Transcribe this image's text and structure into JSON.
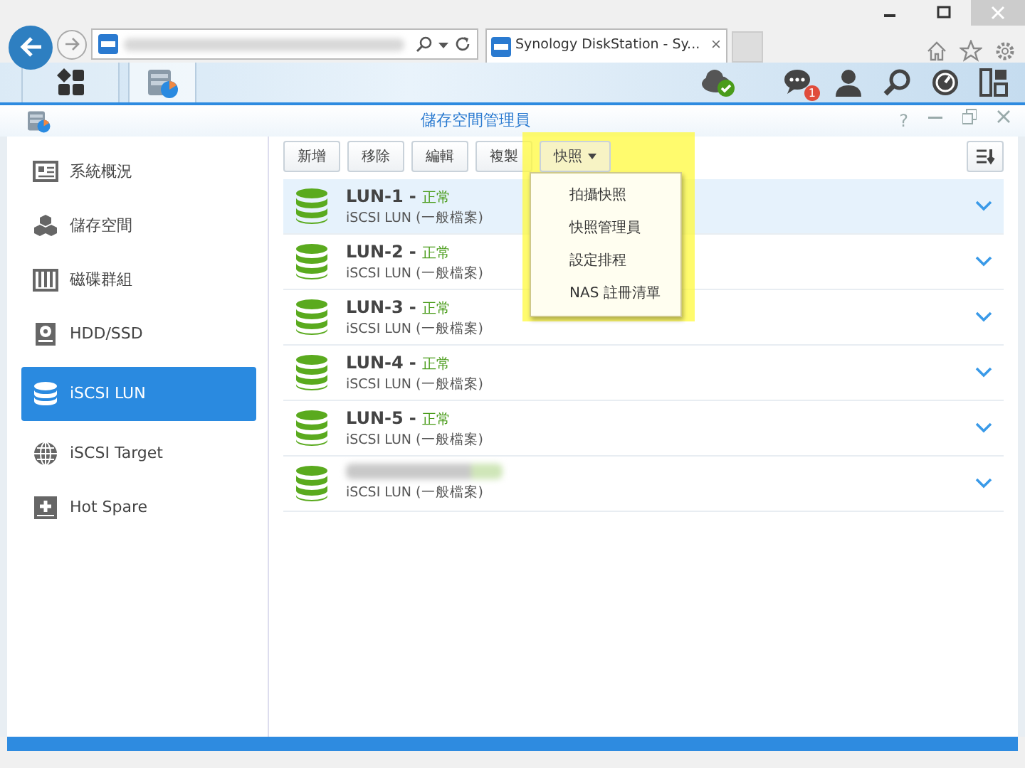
{
  "browser": {
    "tab_title": "Synology DiskStation - Sy...",
    "tab_close": "×"
  },
  "taskbar": {
    "notification_count": "1"
  },
  "window": {
    "title": "儲存空間管理員",
    "help": "?"
  },
  "sidebar": {
    "items": [
      {
        "label": "系統概況",
        "kind": "overview",
        "selected": false
      },
      {
        "label": "儲存空間",
        "kind": "storage",
        "selected": false
      },
      {
        "label": "磁碟群組",
        "kind": "diskgroup",
        "selected": false
      },
      {
        "label": "HDD/SSD",
        "kind": "hdd",
        "selected": false
      },
      {
        "label": "iSCSI LUN",
        "kind": "lun",
        "selected": true
      },
      {
        "label": "iSCSI Target",
        "kind": "globe",
        "selected": false
      },
      {
        "label": "Hot Spare",
        "kind": "plus",
        "selected": false
      }
    ]
  },
  "toolbar": {
    "buttons": [
      "新增",
      "移除",
      "編輯",
      "複製"
    ],
    "dropdown": {
      "label": "快照",
      "expanded": true,
      "items": [
        "拍攝快照",
        "快照管理員",
        "設定排程",
        "NAS 註冊清單"
      ]
    }
  },
  "luns": [
    {
      "name": "LUN-1",
      "separator": "-",
      "status": "正常",
      "type": "iSCSI LUN (一般檔案)",
      "selected": true
    },
    {
      "name": "LUN-2",
      "separator": "-",
      "status": "正常",
      "type": "iSCSI LUN (一般檔案)",
      "selected": false
    },
    {
      "name": "LUN-3",
      "separator": "-",
      "status": "正常",
      "type": "iSCSI LUN (一般檔案)",
      "selected": false
    },
    {
      "name": "LUN-4",
      "separator": "-",
      "status": "正常",
      "type": "iSCSI LUN (一般檔案)",
      "selected": false
    },
    {
      "name": "LUN-5",
      "separator": "-",
      "status": "正常",
      "type": "iSCSI LUN (一般檔案)",
      "selected": false
    },
    {
      "redacted": true,
      "type": "iSCSI LUN (一般檔案)",
      "selected": false
    }
  ]
}
